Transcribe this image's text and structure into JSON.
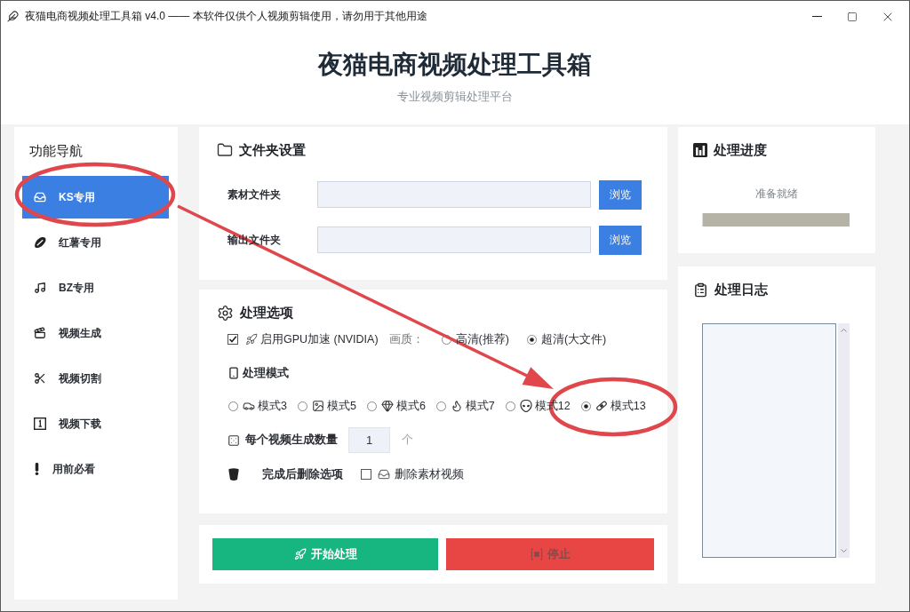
{
  "window": {
    "title": "夜猫电商视频处理工具箱 v4.0 —— 本软件仅供个人视频剪辑使用，请勿用于其他用途"
  },
  "header": {
    "title": "夜猫电商视频处理工具箱",
    "subtitle": "专业视频剪辑处理平台"
  },
  "sidebar": {
    "title": "功能导航",
    "items": [
      {
        "label": "KS专用",
        "selected": true
      },
      {
        "label": "红薯专用",
        "selected": false
      },
      {
        "label": "BZ专用",
        "selected": false
      },
      {
        "label": "视频生成",
        "selected": false
      },
      {
        "label": "视频切割",
        "selected": false
      },
      {
        "label": "视频下载",
        "selected": false
      },
      {
        "label": "用前必看",
        "selected": false
      }
    ]
  },
  "folder_settings": {
    "title": "文件夹设置",
    "rows": [
      {
        "label": "素材文件夹",
        "button": "浏览"
      },
      {
        "label": "输出文件夹",
        "button": "浏览"
      }
    ]
  },
  "processing_options": {
    "title": "处理选项",
    "gpu": {
      "label": "启用GPU加速 (NVIDIA)",
      "checked": true
    },
    "quality": {
      "label": "画质：",
      "options": [
        {
          "label": "高清(推荐)",
          "selected": false
        },
        {
          "label": "超清(大文件)",
          "selected": true
        }
      ]
    },
    "mode": {
      "label": "处理模式",
      "options": [
        {
          "label": "模式3",
          "selected": false
        },
        {
          "label": "模式5",
          "selected": false
        },
        {
          "label": "模式6",
          "selected": false
        },
        {
          "label": "模式7",
          "selected": false
        },
        {
          "label": "模式12",
          "selected": false
        },
        {
          "label": "模式13",
          "selected": true
        }
      ]
    },
    "count": {
      "label": "每个视频生成数量",
      "value": "1",
      "unit": "个"
    },
    "delete": {
      "label": "完成后删除选项",
      "option": {
        "label": "删除素材视频",
        "checked": false
      }
    }
  },
  "actions": [
    {
      "kind": "start",
      "label": "开始处理",
      "disabled": false
    },
    {
      "kind": "stop",
      "label": "停止",
      "disabled": true
    }
  ],
  "progress": {
    "title": "处理进度",
    "status": "准备就绪",
    "level": 0
  },
  "log": {
    "title": "处理日志"
  }
}
